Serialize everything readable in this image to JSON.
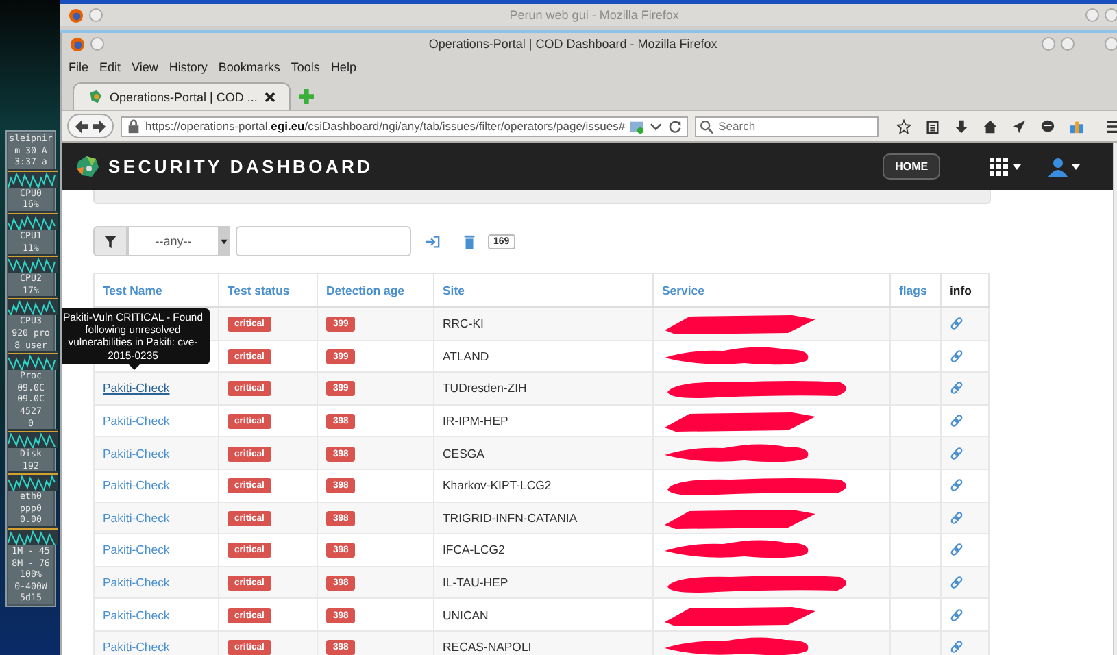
{
  "system_monitor": {
    "items": [
      {
        "kind": "text",
        "text": "sleipnir"
      },
      {
        "kind": "text",
        "text": "m 30 A"
      },
      {
        "kind": "text",
        "text": "3:37 a"
      },
      {
        "kind": "graph"
      },
      {
        "kind": "text",
        "text": "CPU0"
      },
      {
        "kind": "text",
        "text": "16%"
      },
      {
        "kind": "graph"
      },
      {
        "kind": "text",
        "text": "CPU1"
      },
      {
        "kind": "text",
        "text": "11%"
      },
      {
        "kind": "graph"
      },
      {
        "kind": "text",
        "text": "CPU2"
      },
      {
        "kind": "text",
        "text": "17%"
      },
      {
        "kind": "graph"
      },
      {
        "kind": "text",
        "text": "CPU3"
      },
      {
        "kind": "text",
        "text": "920 pro"
      },
      {
        "kind": "text",
        "text": "8 user"
      },
      {
        "kind": "graph"
      },
      {
        "kind": "text",
        "text": "Proc"
      },
      {
        "kind": "text",
        "text": "09.0C"
      },
      {
        "kind": "text",
        "text": "09.0C"
      },
      {
        "kind": "text",
        "text": "4527"
      },
      {
        "kind": "text",
        "text": "0"
      },
      {
        "kind": "graph"
      },
      {
        "kind": "text",
        "text": "Disk"
      },
      {
        "kind": "text",
        "text": "192"
      },
      {
        "kind": "graph"
      },
      {
        "kind": "text",
        "text": "eth0"
      },
      {
        "kind": "text",
        "text": "ppp0"
      },
      {
        "kind": "text",
        "text": "0.00"
      },
      {
        "kind": "graph"
      },
      {
        "kind": "text",
        "text": "1M - 45"
      },
      {
        "kind": "text",
        "text": "8M - 76"
      },
      {
        "kind": "text",
        "text": "100%"
      },
      {
        "kind": "text",
        "text": "0-400W"
      },
      {
        "kind": "text",
        "text": "5d15"
      }
    ]
  },
  "outer_window": {
    "title": "Perun web gui - Mozilla Firefox"
  },
  "window": {
    "title": "Operations-Portal | COD Dashboard - Mozilla Firefox"
  },
  "menu": [
    "File",
    "Edit",
    "View",
    "History",
    "Bookmarks",
    "Tools",
    "Help"
  ],
  "tabs": [
    {
      "label": "Operations-Portal | COD ...",
      "selected": true
    }
  ],
  "address_bar": {
    "value": "https://operations-portal.**egi.eu**/csiDashboard/ngi/any/tab/issues/filter/operators/page/issues#"
  },
  "search": {
    "placeholder": "Search"
  },
  "header": {
    "title": "SECURITY DASHBOARD",
    "home_button": "HOME"
  },
  "filter": {
    "select_value": "--any--",
    "count": "169"
  },
  "tooltip": {
    "text": "Pakiti-Vuln CRITICAL - Found following unresolved vulnerabilities in Pakiti: cve-2015-0235"
  },
  "table": {
    "columns": [
      "Test Name",
      "Test status",
      "Detection age",
      "Site",
      "Service",
      "flags",
      "info"
    ],
    "rows": [
      {
        "status": "critical",
        "age": "399",
        "site": "RRC-KI",
        "redacted": true
      },
      {
        "status": "critical",
        "age": "399",
        "site": "ATLAND",
        "redacted": true
      },
      {
        "test_name": "Pakiti-Check",
        "status": "critical",
        "age": "399",
        "site": "TUDresden-ZIH",
        "redacted": true,
        "hovered": true
      },
      {
        "test_name": "Pakiti-Check",
        "status": "critical",
        "age": "398",
        "site": "IR-IPM-HEP",
        "redacted": true,
        "hovered": false
      },
      {
        "test_name": "Pakiti-Check",
        "status": "critical",
        "age": "398",
        "site": "CESGA",
        "redacted": true,
        "hovered": false
      },
      {
        "test_name": "Pakiti-Check",
        "status": "critical",
        "age": "398",
        "site": "Kharkov-KIPT-LCG2",
        "redacted": true,
        "hovered": false
      },
      {
        "test_name": "Pakiti-Check",
        "status": "critical",
        "age": "398",
        "site": "TRIGRID-INFN-CATANIA",
        "redacted": true,
        "hovered": false
      },
      {
        "test_name": "Pakiti-Check",
        "status": "critical",
        "age": "398",
        "site": "IFCA-LCG2",
        "redacted": true,
        "hovered": false
      },
      {
        "test_name": "Pakiti-Check",
        "status": "critical",
        "age": "398",
        "site": "IL-TAU-HEP",
        "redacted": true,
        "hovered": false
      },
      {
        "test_name": "Pakiti-Check",
        "status": "critical",
        "age": "398",
        "site": "UNICAN",
        "redacted": true,
        "hovered": false
      },
      {
        "test_name": "Pakiti-Check",
        "status": "critical",
        "age": "398",
        "site": "RECAS-NAPOLI",
        "redacted": true,
        "hovered": false
      }
    ]
  }
}
